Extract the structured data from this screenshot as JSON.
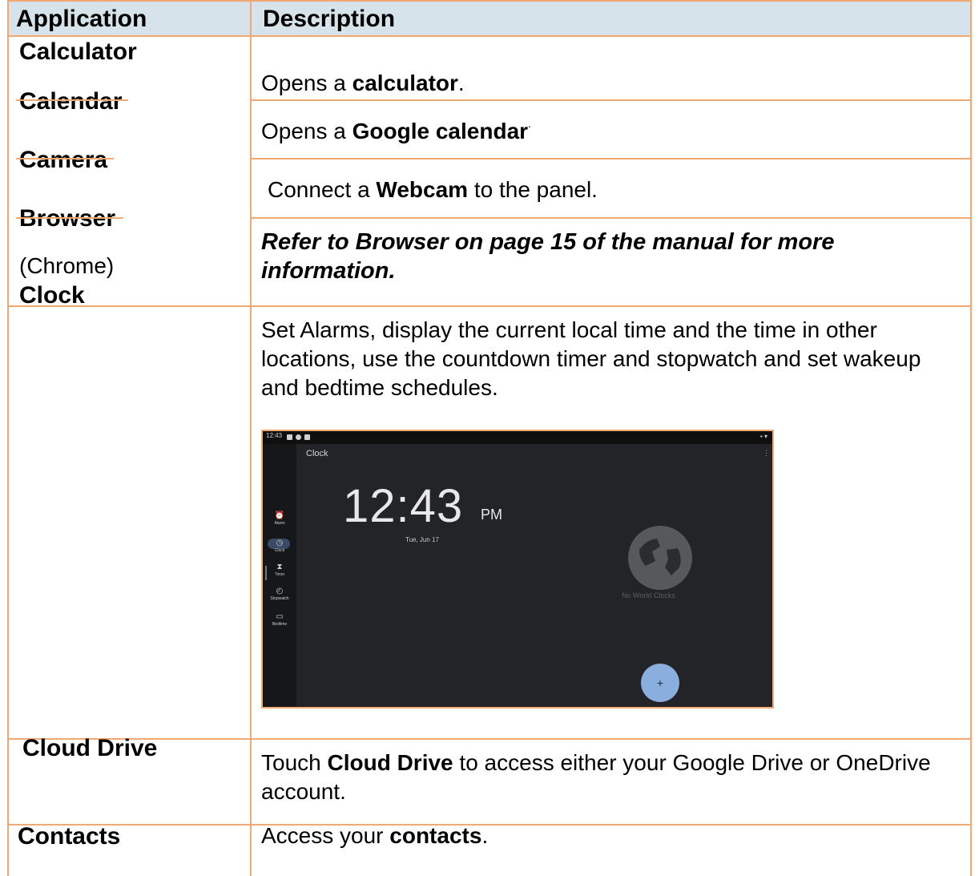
{
  "header": {
    "application": "Application",
    "description": "Description"
  },
  "rows": {
    "calculator": {
      "app": "Calculator",
      "desc_pre": "Opens a ",
      "desc_bold": "calculator",
      "desc_post": "."
    },
    "calendar": {
      "app": "Calendar",
      "desc_pre": "Opens a ",
      "desc_bold": "Google calendar",
      "desc_post": "."
    },
    "camera": {
      "app": "Camera",
      "desc_pre": "Connect a ",
      "desc_bold": "Webcam",
      "desc_post": " to the panel."
    },
    "browser": {
      "app": "Browser",
      "app_sub": "(Chrome)",
      "desc_italic": "Refer to Browser on page 15 of the manual for more information."
    },
    "clock": {
      "app": "Clock",
      "desc": "Set Alarms, display the current local time and the time in other locations, use the countdown timer and stopwatch and set wakeup and bedtime schedules.",
      "screenshot": {
        "status_time": "12:43",
        "title": "Clock",
        "time": "12:43",
        "ampm": "PM",
        "date": "Tue, Jun 17",
        "empty_text": "No World Clocks",
        "fab_icon": "+",
        "nav": [
          {
            "icon": "⏰",
            "label": "Alarm"
          },
          {
            "icon": "◷",
            "label": "Clock"
          },
          {
            "icon": "⧗",
            "label": "Timer"
          },
          {
            "icon": "◴",
            "label": "Stopwatch"
          },
          {
            "icon": "▭",
            "label": "Bedtime"
          }
        ]
      }
    },
    "cloud_drive": {
      "app": "Cloud Drive",
      "desc_pre": "Touch ",
      "desc_bold": "Cloud Drive",
      "desc_post": " to access either your Google Drive or OneDrive account."
    },
    "contacts": {
      "app": "Contacts",
      "desc_pre": "Access your ",
      "desc_bold": "contacts",
      "desc_post": "."
    }
  },
  "colors": {
    "border": "#f2a873",
    "header_bg": "#d6e3ea"
  }
}
